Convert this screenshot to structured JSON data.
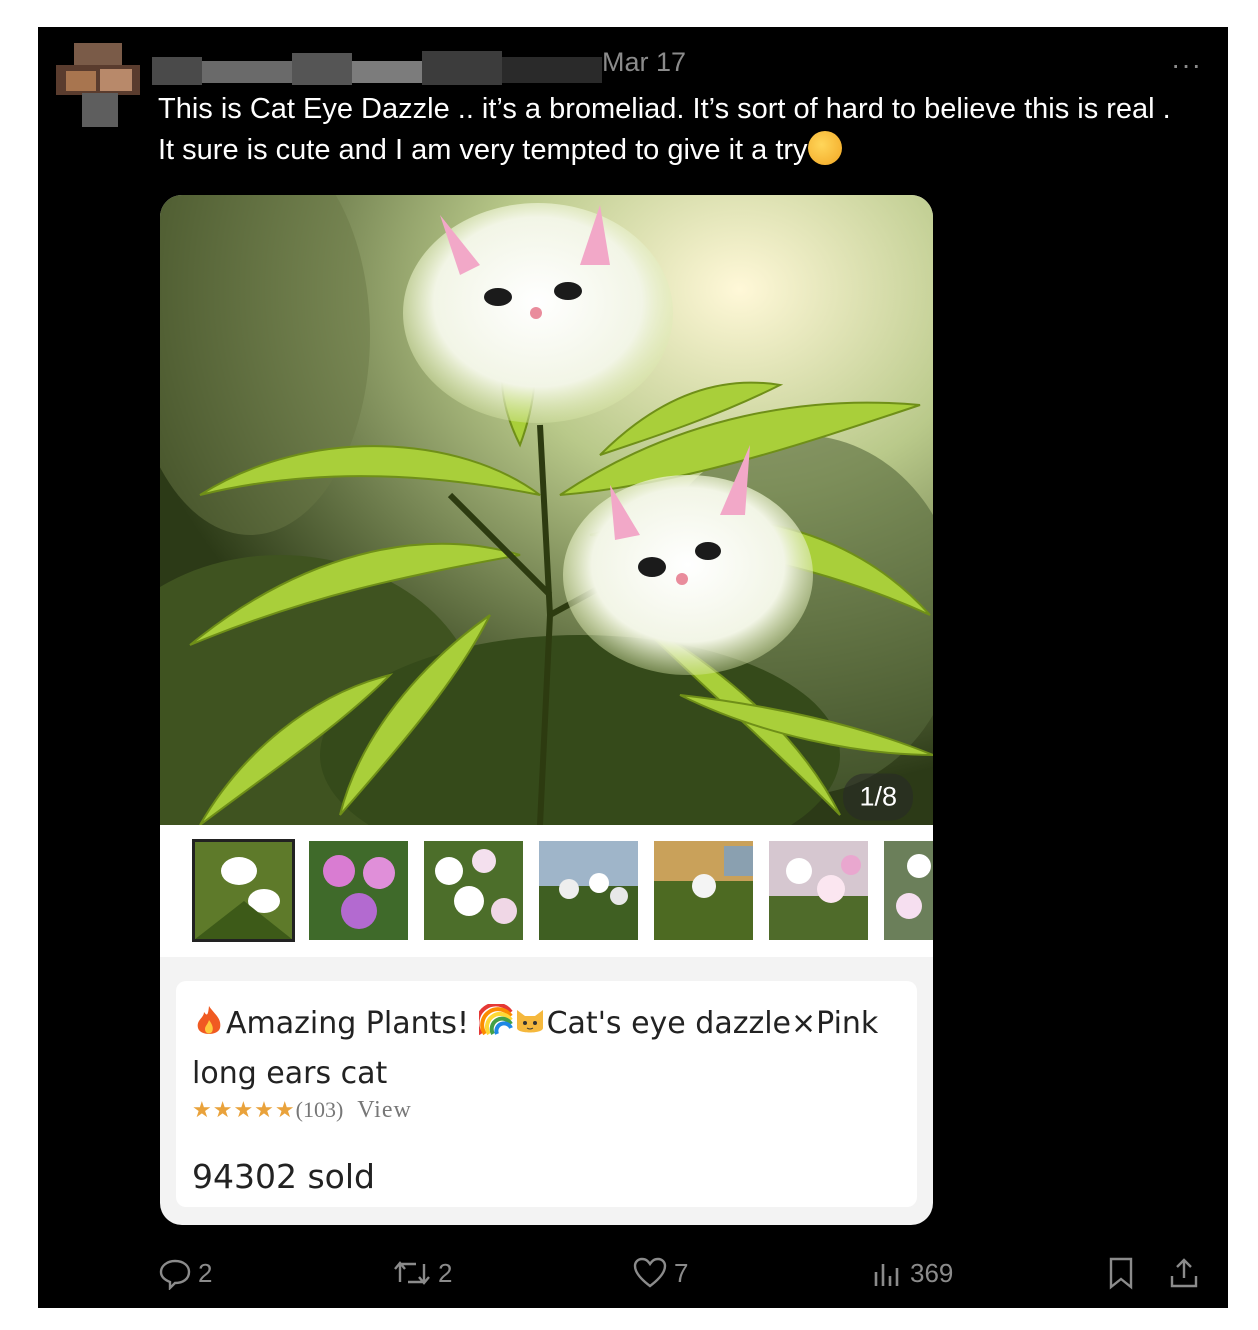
{
  "post": {
    "date": "Mar 17",
    "more": "···",
    "text": "This is Cat Eye Dazzle .. it’s a bromeliad. It’s sort of hard to believe this is real . It sure is cute and I am very tempted to give it a try",
    "emoji_icon": "thinking-face-icon"
  },
  "media": {
    "counter": "1/8",
    "thumbnail_count": 7,
    "selected_thumbnail": 1
  },
  "product": {
    "title_part1": "Amazing Plants! ",
    "title_part2": "Cat's eye dazzle×Pink long ears cat",
    "rating_stars": "★★★★★",
    "rating_count": "(103)",
    "view_label": "View",
    "sold": "94302 sold",
    "title_icons": [
      "fire-icon",
      "rainbow-icon",
      "cat-face-icon"
    ]
  },
  "actions": {
    "replies": "2",
    "reposts": "2",
    "likes": "7",
    "views": "369"
  },
  "colors": {
    "background": "#000000",
    "text": "#ffffff",
    "muted": "#8b8b8b",
    "star": "#e9a23b"
  }
}
